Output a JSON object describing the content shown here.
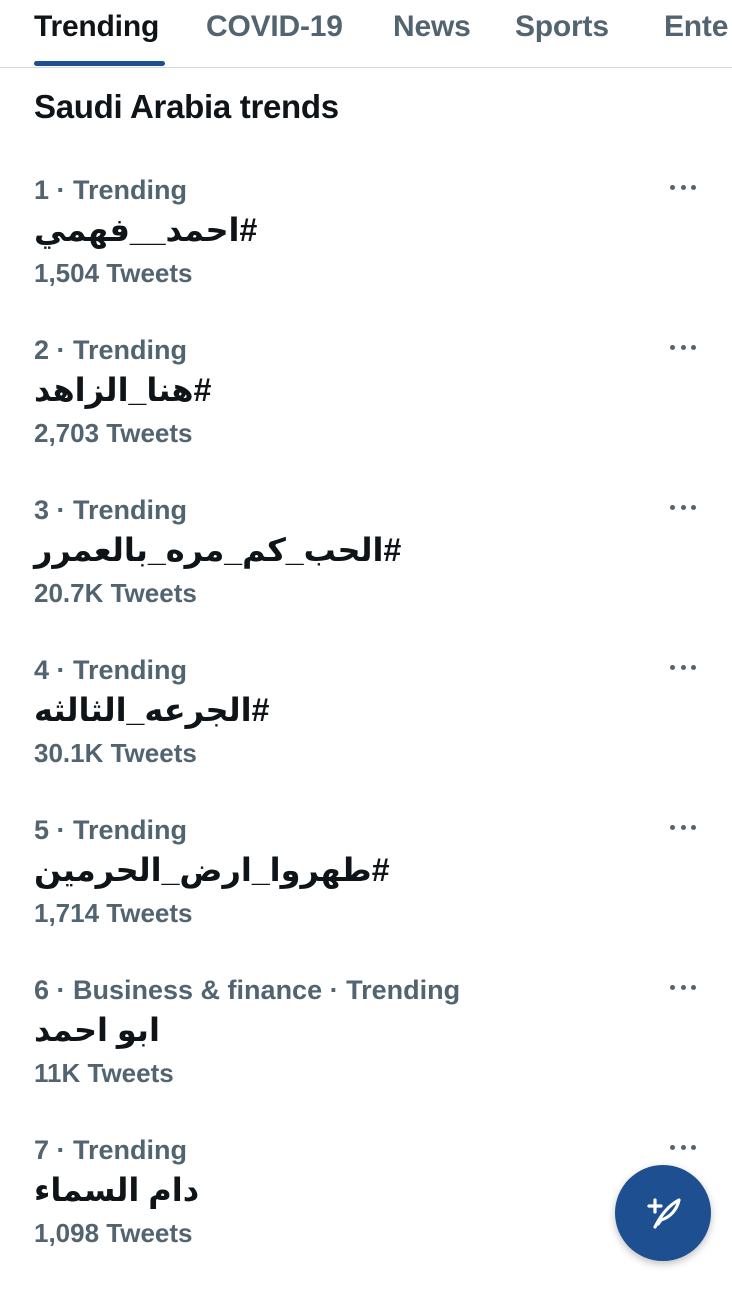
{
  "tabs": [
    {
      "label": "Trending",
      "active": true
    },
    {
      "label": "COVID-19",
      "active": false
    },
    {
      "label": "News",
      "active": false
    },
    {
      "label": "Sports",
      "active": false
    },
    {
      "label": "Ente",
      "active": false
    }
  ],
  "section_title": "Saudi Arabia trends",
  "trends": [
    {
      "meta": "1 · Trending",
      "name": "#احمد__فهمي",
      "count": "1,504 Tweets"
    },
    {
      "meta": "2 · Trending",
      "name": "#هنا_الزاهد",
      "count": "2,703 Tweets"
    },
    {
      "meta": "3 · Trending",
      "name": "#الحب_كم_مره_بالعمرر",
      "count": "20.7K Tweets"
    },
    {
      "meta": "4 · Trending",
      "name": "#الجرعه_الثالثه",
      "count": "30.1K Tweets"
    },
    {
      "meta": "5 · Trending",
      "name": "#طهروا_ارض_الحرمين",
      "count": "1,714 Tweets"
    },
    {
      "meta": "6 · Business & finance · Trending",
      "name": "ابو احمد",
      "count": "11K Tweets"
    },
    {
      "meta": "7 · Trending",
      "name": "دام السماء",
      "count": "1,098 Tweets"
    }
  ],
  "icons": {
    "more": "more-horizontal-icon",
    "compose": "compose-tweet-icon"
  },
  "colors": {
    "accent": "#1d4f91",
    "text_primary": "#0f1419",
    "text_secondary": "#536471",
    "divider": "#cfd9de"
  }
}
